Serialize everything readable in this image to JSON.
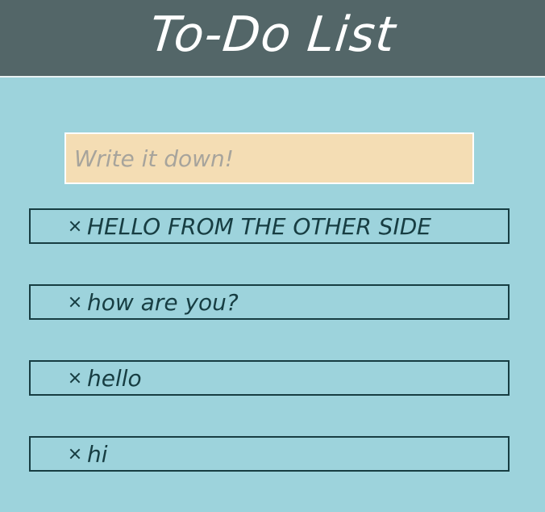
{
  "app": {
    "title": "To-Do List"
  },
  "input": {
    "placeholder": "Write it down!",
    "value": ""
  },
  "todos": [
    {
      "label": "HELLO FROM THE OTHER SIDE"
    },
    {
      "label": "how are you?"
    },
    {
      "label": "hello"
    },
    {
      "label": "hi"
    }
  ],
  "icons": {
    "delete": "close-icon"
  },
  "colors": {
    "background": "#9dd3dc",
    "header": "#536668",
    "input_background": "#f4ddb4",
    "text": "#173d42"
  }
}
